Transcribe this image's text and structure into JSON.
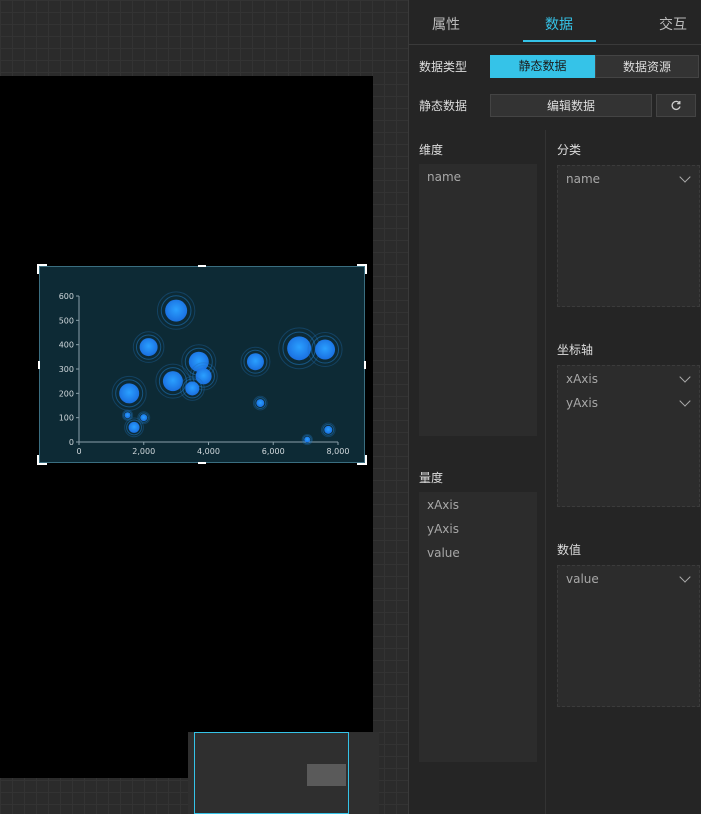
{
  "tabs": [
    {
      "label": "属性",
      "active": false
    },
    {
      "label": "数据",
      "active": true
    },
    {
      "label": "交互",
      "active": false
    }
  ],
  "data_type": {
    "label": "数据类型",
    "options": [
      "静态数据",
      "数据资源"
    ],
    "selected": "静态数据"
  },
  "static_data": {
    "label": "静态数据",
    "edit_button": "编辑数据",
    "refresh_icon": "refresh-icon"
  },
  "dimension": {
    "title": "维度",
    "fields": [
      "name"
    ]
  },
  "measure": {
    "title": "量度",
    "fields": [
      "xAxis",
      "yAxis",
      "value"
    ]
  },
  "category": {
    "title": "分类",
    "fields": [
      "name"
    ]
  },
  "axis": {
    "title": "坐标轴",
    "fields": [
      "xAxis",
      "yAxis"
    ]
  },
  "value_section": {
    "title": "数值",
    "fields": [
      "value"
    ]
  },
  "colors": {
    "accent": "#35c3e8",
    "panel_bg": "#252525",
    "chart_bg": "#0d2a35"
  },
  "chart_data": {
    "type": "scatter",
    "xlim": [
      0,
      8000
    ],
    "ylim": [
      0,
      600
    ],
    "xticks": [
      "0",
      "2,000",
      "4,000",
      "6,000",
      "8,000"
    ],
    "yticks": [
      "0",
      "100",
      "200",
      "300",
      "400",
      "500",
      "600"
    ],
    "points": [
      {
        "x": 3000,
        "y": 540,
        "size": 22
      },
      {
        "x": 2150,
        "y": 390,
        "size": 18
      },
      {
        "x": 3700,
        "y": 330,
        "size": 20
      },
      {
        "x": 3850,
        "y": 270,
        "size": 16
      },
      {
        "x": 2900,
        "y": 250,
        "size": 20
      },
      {
        "x": 3500,
        "y": 220,
        "size": 14
      },
      {
        "x": 1550,
        "y": 200,
        "size": 20
      },
      {
        "x": 5450,
        "y": 330,
        "size": 17
      },
      {
        "x": 6800,
        "y": 385,
        "size": 24
      },
      {
        "x": 7600,
        "y": 380,
        "size": 20
      },
      {
        "x": 5600,
        "y": 160,
        "size": 8
      },
      {
        "x": 1500,
        "y": 110,
        "size": 6
      },
      {
        "x": 2000,
        "y": 100,
        "size": 7
      },
      {
        "x": 1700,
        "y": 60,
        "size": 11
      },
      {
        "x": 7050,
        "y": 10,
        "size": 6
      },
      {
        "x": 7700,
        "y": 50,
        "size": 8
      }
    ]
  }
}
